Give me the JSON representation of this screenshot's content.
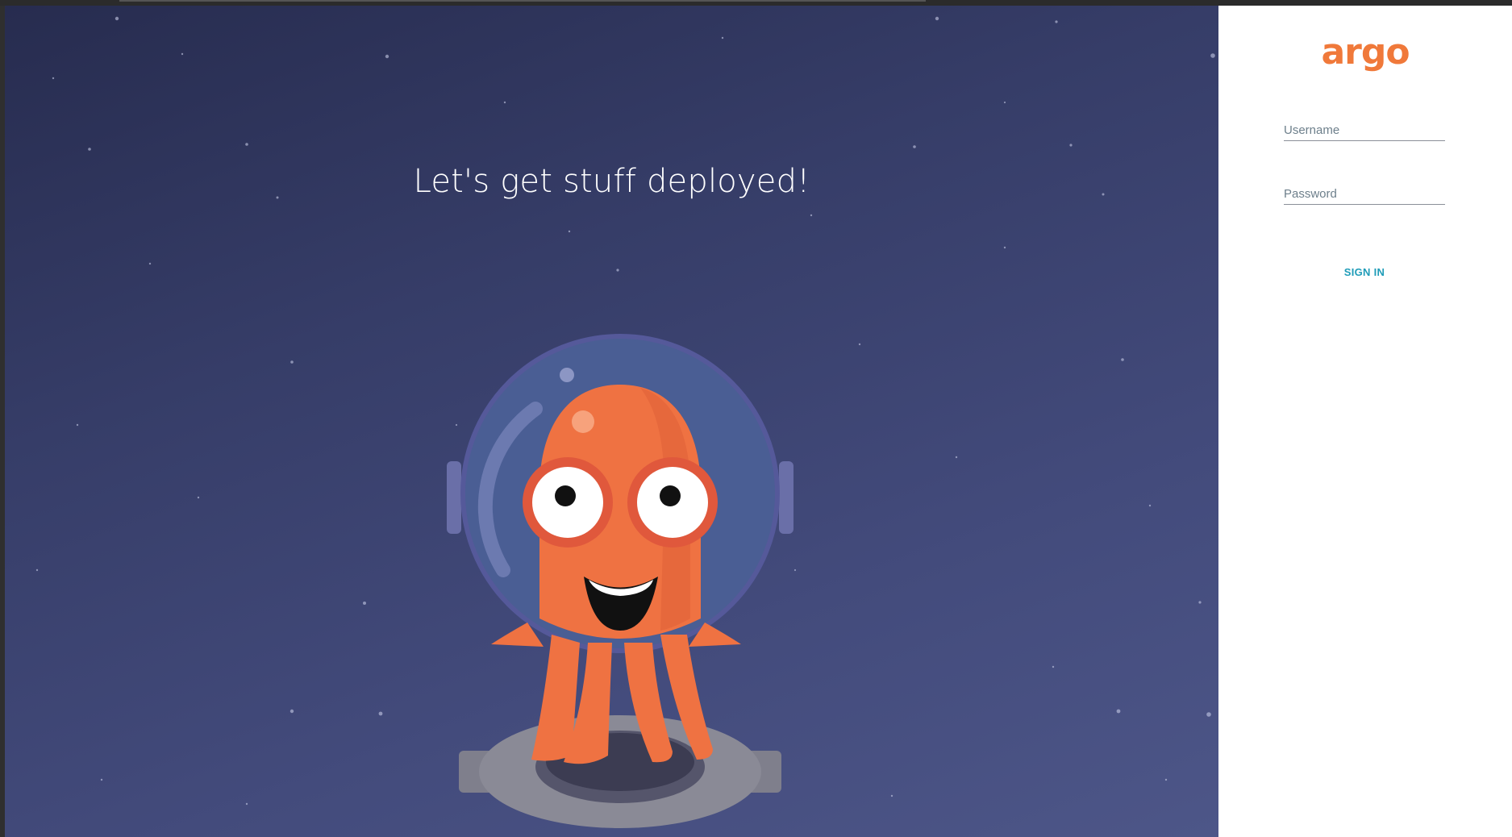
{
  "hero": {
    "headline": "Let's get stuff deployed!",
    "illustration_icon": "argo-octopus-astronaut-icon"
  },
  "login": {
    "logo_text": "argo",
    "username_placeholder": "Username",
    "password_placeholder": "Password",
    "sign_in_label": "SIGN IN"
  },
  "colors": {
    "brand_orange": "#f0793a",
    "accent_teal": "#1f9cb8",
    "hero_background": "#3a4272",
    "panel_background": "#ffffff"
  }
}
